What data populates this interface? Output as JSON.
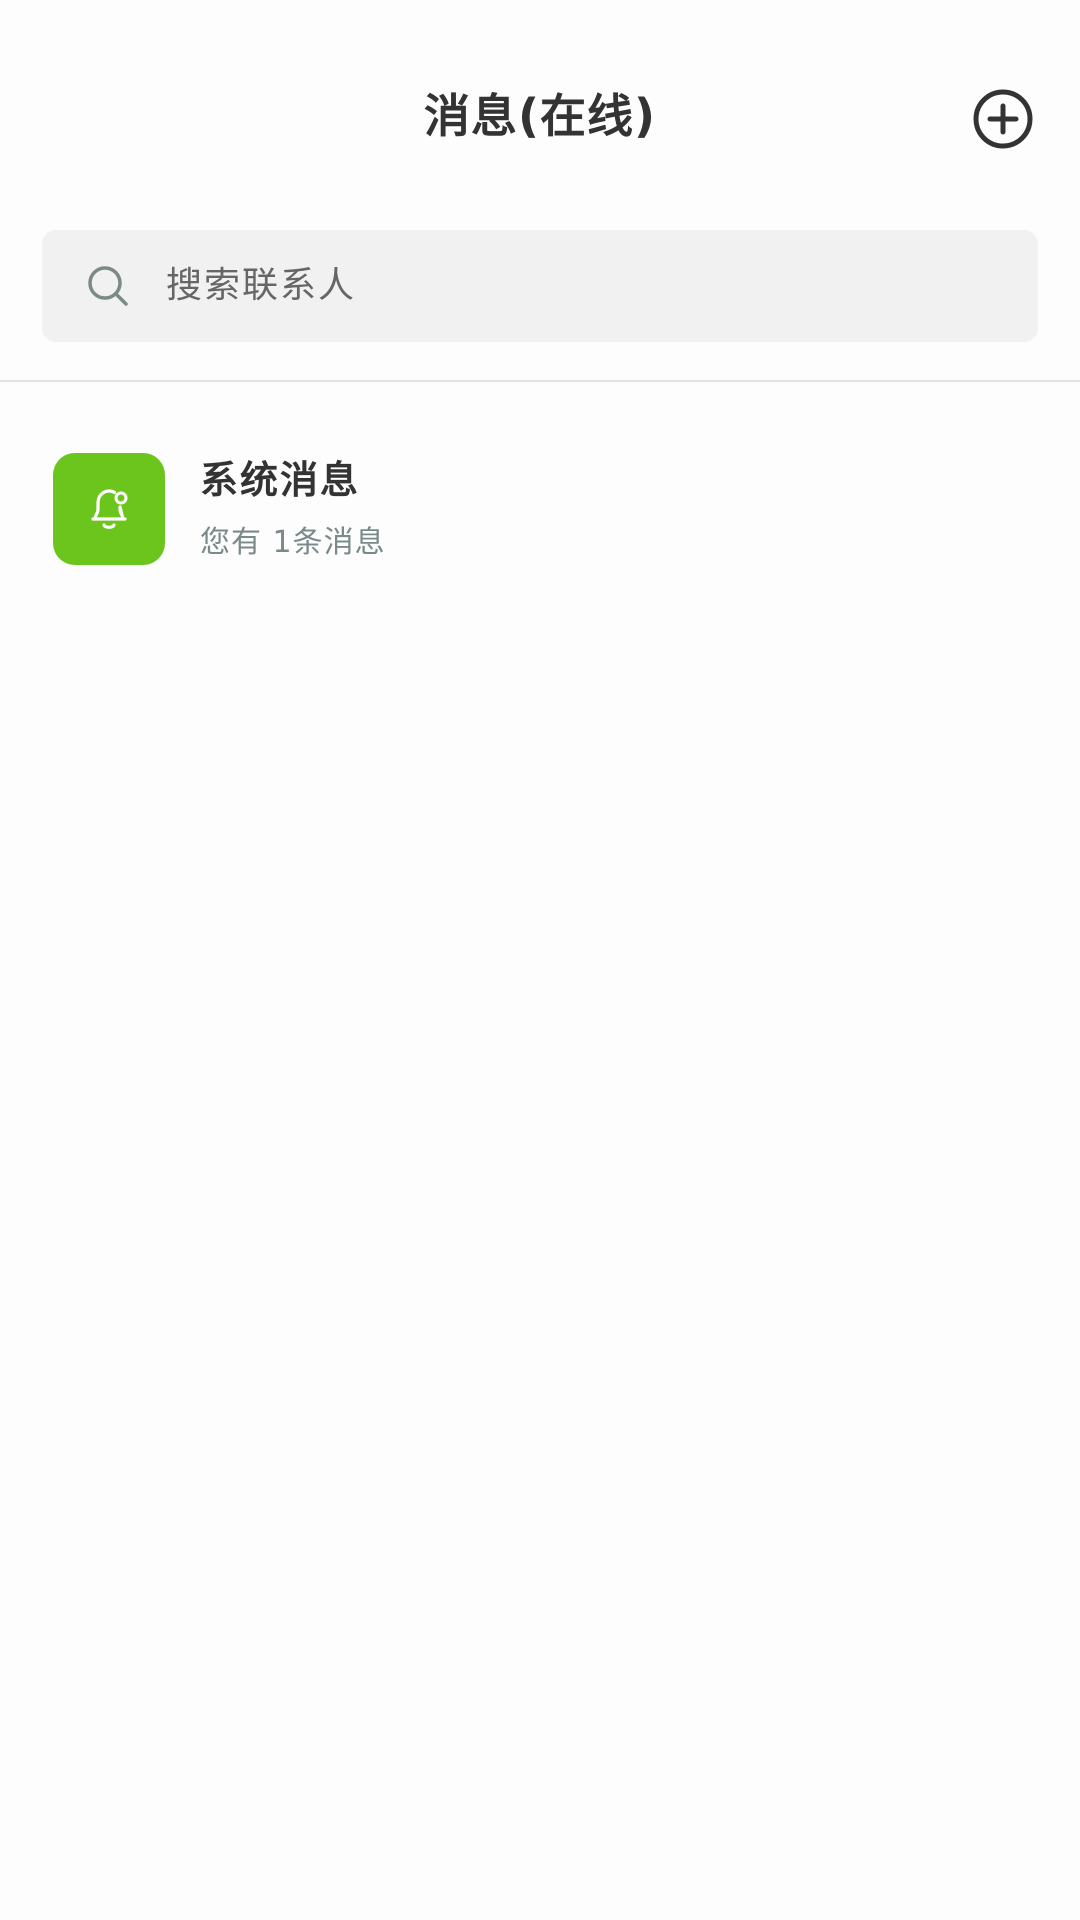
{
  "header": {
    "title": "消息(在线)",
    "add_icon": "plus-circle-icon"
  },
  "search": {
    "placeholder": "搜索联系人",
    "icon": "search-icon"
  },
  "conversations": [
    {
      "name": "系统消息",
      "preview": "您有 1条消息",
      "avatar_icon": "bell-icon",
      "avatar_color": "#6cc51d"
    }
  ],
  "colors": {
    "accent": "#6cc51d",
    "text_primary": "#333333",
    "text_secondary": "#7a8a8a",
    "search_bg": "#f1f1f1"
  }
}
